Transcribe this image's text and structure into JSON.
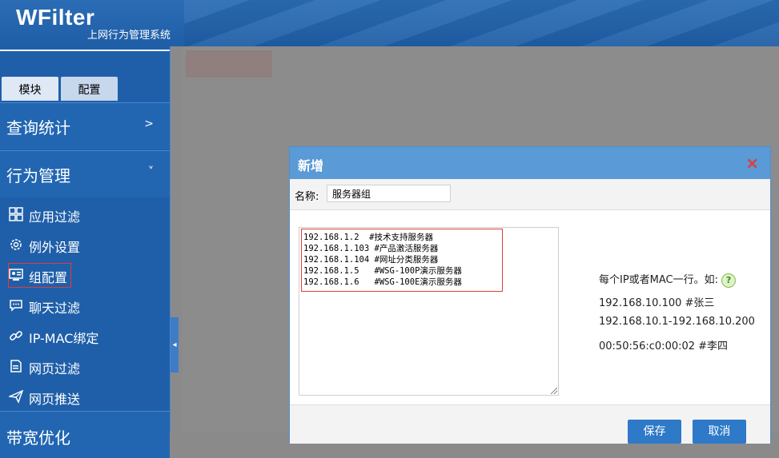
{
  "header": {
    "logo": "WFilter",
    "subtitle": "上网行为管理系统"
  },
  "sidebar": {
    "tabs": [
      "模块",
      "配置"
    ],
    "sections": [
      {
        "label": "查询统计",
        "chevron": ">"
      },
      {
        "label": "行为管理",
        "chevron": "˅"
      }
    ],
    "items": [
      {
        "label": "应用过滤",
        "icon": "grid-icon"
      },
      {
        "label": "例外设置",
        "icon": "gear-icon"
      },
      {
        "label": "组配置",
        "icon": "group-card-icon",
        "active": true
      },
      {
        "label": "聊天过滤",
        "icon": "chat-icon"
      },
      {
        "label": "IP-MAC绑定",
        "icon": "link-icon"
      },
      {
        "label": "网页过滤",
        "icon": "page-icon"
      },
      {
        "label": "网页推送",
        "icon": "send-icon"
      }
    ],
    "next_section": "带宽优化"
  },
  "dialog": {
    "title": "新增",
    "close": "×",
    "name_label": "名称:",
    "name_value": "服务器组",
    "entries": [
      "192.168.1.2  #技术支持服务器",
      "192.168.1.103 #产品激活服务器",
      "192.168.1.104 #网址分类服务器",
      "192.168.1.5   #WSG-100P演示服务器",
      "192.168.1.6   #WSG-100E演示服务器"
    ],
    "help": {
      "line1": "每个IP或者MAC一行。如:",
      "qmark": "?",
      "line2": "192.168.10.100 #张三",
      "line3": "192.168.10.1-192.168.10.200",
      "line4": "00:50:56:c0:00:02 #李四"
    },
    "save_label": "保存",
    "cancel_label": "取消"
  },
  "colors": {
    "header_blue": "#1f5ea6",
    "sidebar_blue": "#1f5fa9",
    "dialog_title": "#5a9ad6",
    "button_blue": "#2e79c8",
    "highlight_red": "#e23b3b"
  }
}
